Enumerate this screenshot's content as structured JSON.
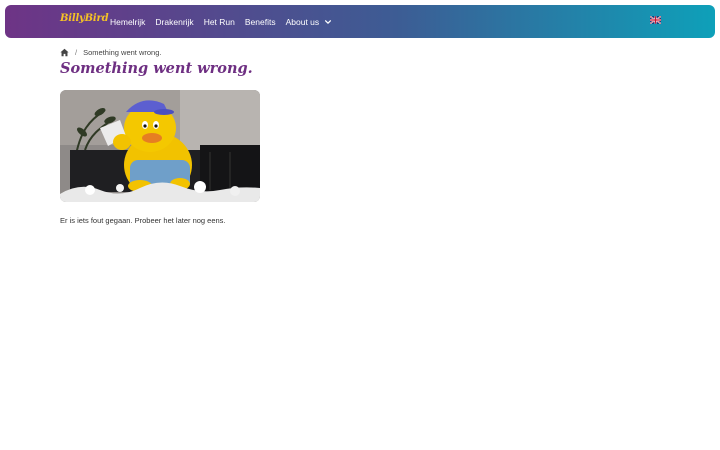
{
  "navbar": {
    "logo_text": "BillyBird",
    "items": [
      {
        "label": "Hemelrijk"
      },
      {
        "label": "Drakenrijk"
      },
      {
        "label": "Het Run"
      },
      {
        "label": "Benefits"
      },
      {
        "label": "About us",
        "has_dropdown": true
      }
    ],
    "language_icon": "uk-flag-icon",
    "colors": {
      "gradient_start": "#6e3486",
      "gradient_end": "#0ea0b9",
      "logo": "#f6c325"
    }
  },
  "breadcrumb": {
    "home_icon": "home-icon",
    "separator": "/",
    "current": "Something went wrong."
  },
  "page": {
    "title": "Something went wrong.",
    "title_color": "#6e2f82",
    "message": "Er is iets fout gegaan. Probeer het later nog eens."
  }
}
